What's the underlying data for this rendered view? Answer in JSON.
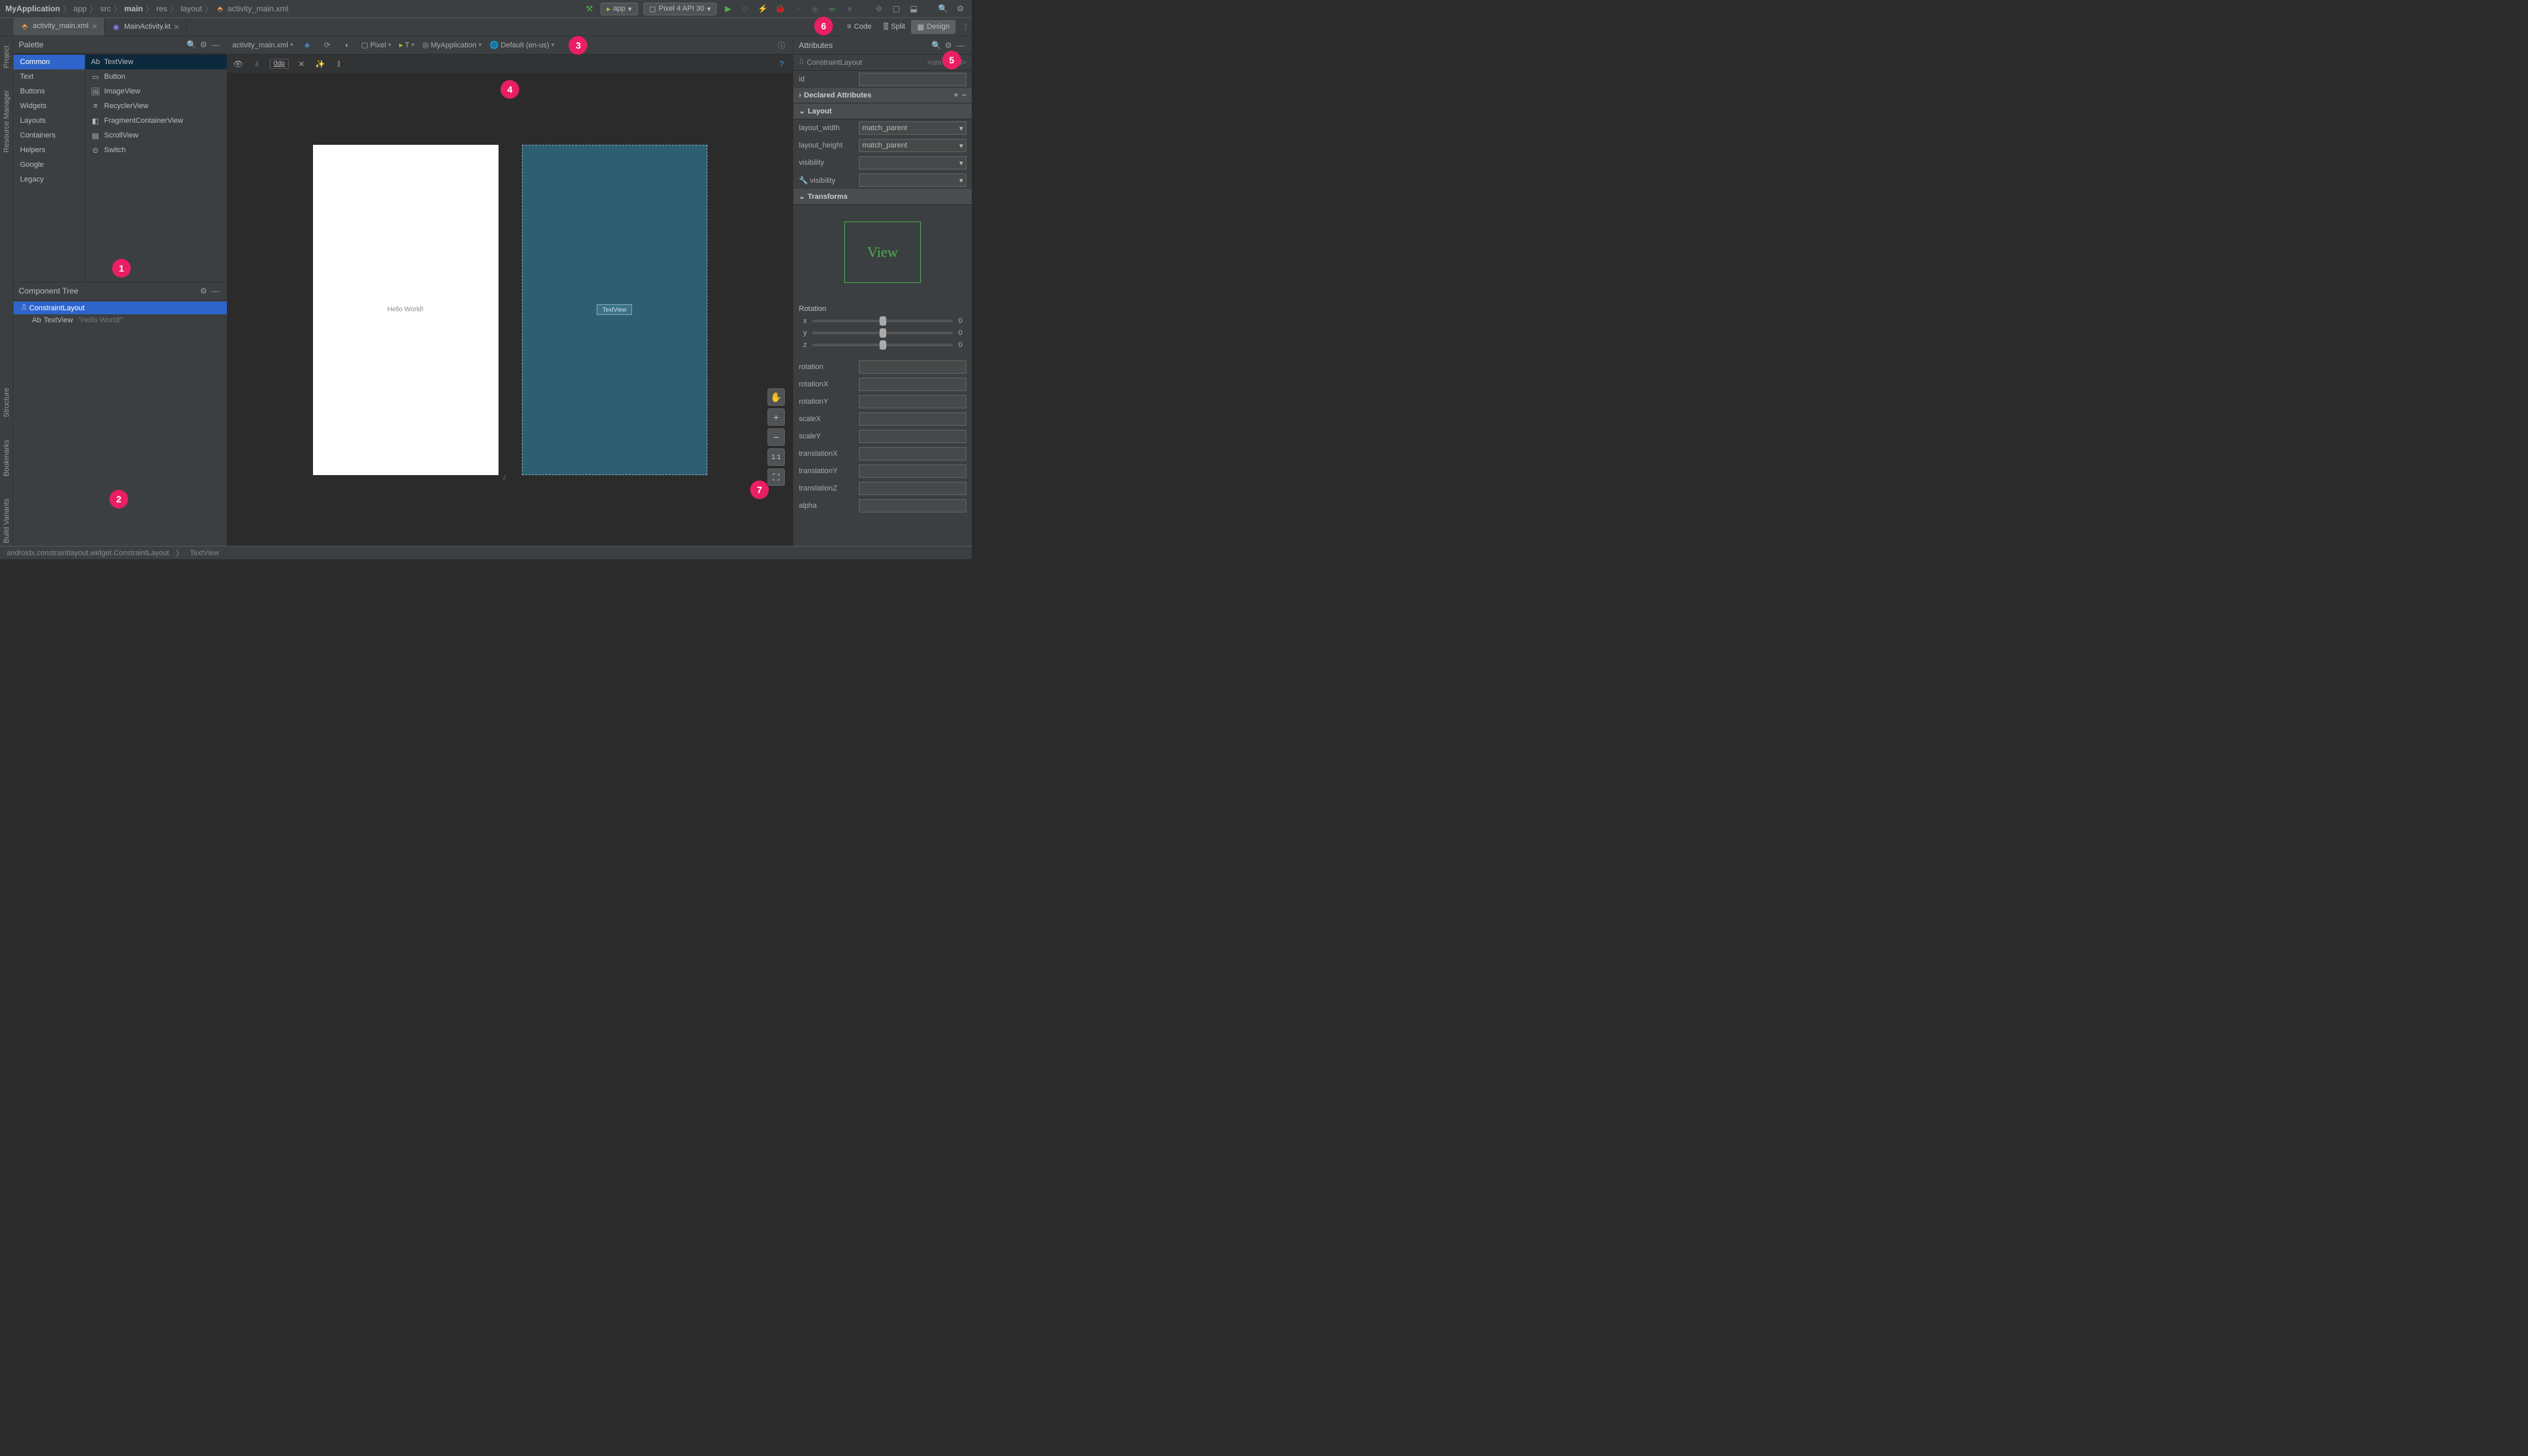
{
  "breadcrumb": [
    "MyApplication",
    "app",
    "src",
    "main",
    "res",
    "layout",
    "activity_main.xml"
  ],
  "tabs": [
    {
      "label": "activity_main.xml",
      "active": true
    },
    {
      "label": "MainActivity.kt",
      "active": false
    }
  ],
  "run_configs": {
    "app": "app",
    "device": "Pixel 4 API 30"
  },
  "left_gutter": [
    "Project",
    "Resource Manager",
    "Structure",
    "Bookmarks",
    "Build Variants"
  ],
  "palette": {
    "title": "Palette",
    "categories": [
      "Common",
      "Text",
      "Buttons",
      "Widgets",
      "Layouts",
      "Containers",
      "Helpers",
      "Google",
      "Legacy"
    ],
    "items": [
      "TextView",
      "Button",
      "ImageView",
      "RecyclerView",
      "FragmentContainerView",
      "ScrollView",
      "Switch"
    ]
  },
  "component_tree": {
    "title": "Component Tree",
    "root": "ConstraintLayout",
    "child": "TextView",
    "child_hint": "\"Hello World!\""
  },
  "design_toolbar": {
    "file": "activity_main.xml",
    "device": "Pixel",
    "theme": "T",
    "app": "MyApplication",
    "locale": "Default (en-us)",
    "margin": "0dp"
  },
  "canvas": {
    "hello": "Hello World!",
    "bp_label": "TextView"
  },
  "zoom_labels": {
    "one_to_one": "1:1"
  },
  "view_modes": {
    "code": "Code",
    "split": "Split",
    "design": "Design"
  },
  "attributes": {
    "title": "Attributes",
    "type": "ConstraintLayout",
    "unnamed": "<unnamed>",
    "id_label": "id",
    "declared": "Declared Attributes",
    "layout": "Layout",
    "layout_width_label": "layout_width",
    "layout_width_val": "match_parent",
    "layout_height_label": "layout_height",
    "layout_height_val": "match_parent",
    "visibility_label": "visibility",
    "tools_visibility_label": "visibility",
    "transforms": "Transforms",
    "view_text": "View",
    "rotation": "Rotation",
    "sliders": [
      {
        "axis": "x",
        "val": "0"
      },
      {
        "axis": "y",
        "val": "0"
      },
      {
        "axis": "z",
        "val": "0"
      }
    ],
    "fields": [
      "rotation",
      "rotationX",
      "rotationY",
      "scaleX",
      "scaleY",
      "translationX",
      "translationY",
      "translationZ",
      "alpha"
    ]
  },
  "status_bar": {
    "path": "androidx.constraintlayout.widget.ConstraintLayout",
    "item": "TextView"
  },
  "markers": [
    "1",
    "2",
    "3",
    "4",
    "5",
    "6",
    "7"
  ]
}
